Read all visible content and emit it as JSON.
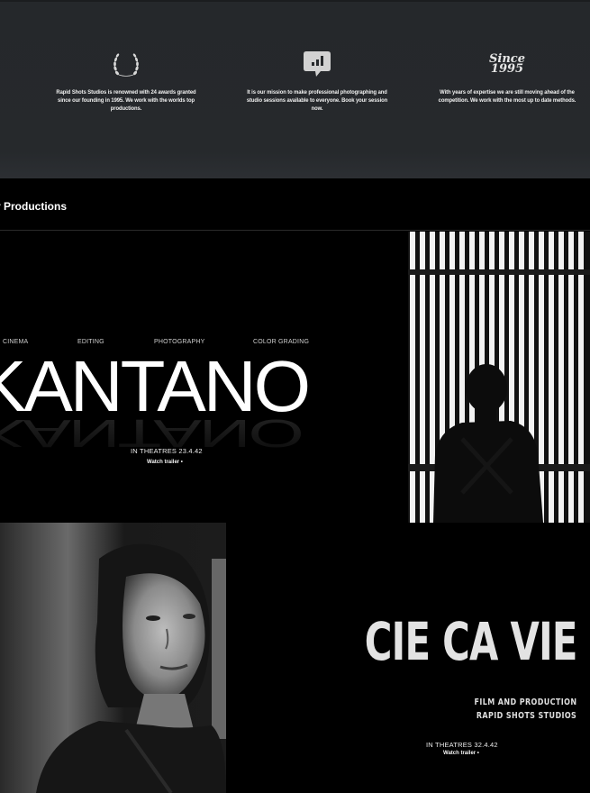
{
  "features": [
    {
      "icon": "laurel-wreath-icon",
      "text": "Rapid Shots Studios is renowned with 24 awards granted since our founding in 1995. We work with the worlds top productions."
    },
    {
      "icon": "chart-speech-bubble-icon",
      "text": "It is our mission to make professional photographing and studio sessions available to everyone. Book your session now."
    },
    {
      "icon": "since-1995-badge",
      "badge_line1": "Since",
      "badge_line2": "1995",
      "text": "With years of expertise we are still moving ahead of the competition. We work with the most up to date methods."
    }
  ],
  "productions_heading": "r Productions",
  "kantano": {
    "categories": [
      "CINEMA",
      "EDITING",
      "PHOTOGRAPHY",
      "COLOR GRADING"
    ],
    "title": "KANTANO",
    "date": "IN THEATRES 23.4.42",
    "trailer": "Watch trailer •"
  },
  "cie": {
    "title": "CIE CA VIE",
    "subtitle_line1": "FILM AND PRODUCTION",
    "subtitle_line2": "RAPID SHOTS STUDIOS",
    "date": "IN THEATRES 32.4.42",
    "trailer": "Watch trailer •"
  },
  "colors": {
    "feature_band": "#26292c",
    "page_background": "#000000",
    "text": "#ffffff"
  }
}
